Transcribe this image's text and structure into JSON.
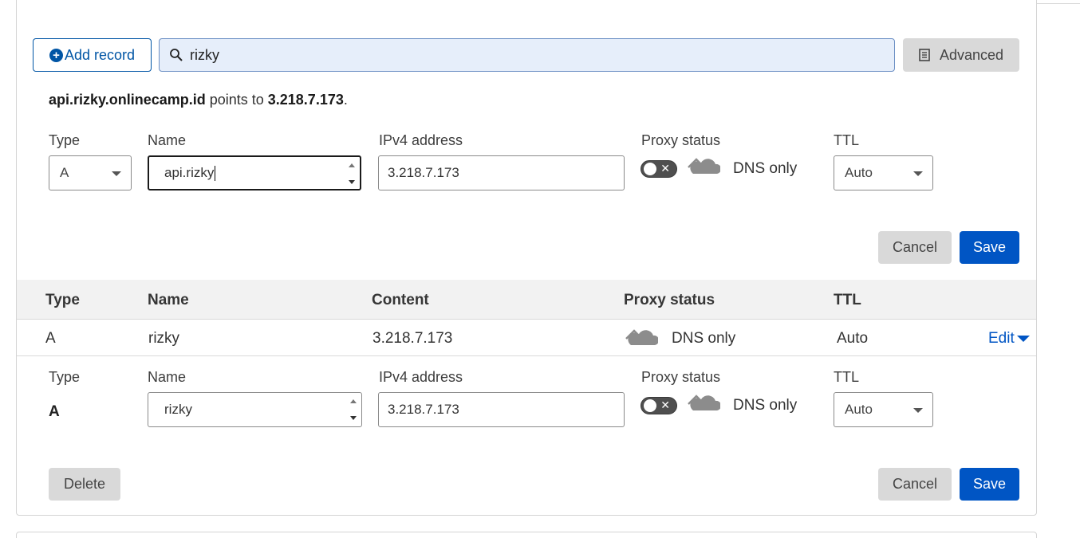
{
  "toolbar": {
    "add_record_label": "Add record",
    "search_value": "rizky",
    "advanced_label": "Advanced"
  },
  "preview": {
    "host": "api.rizky.onlinecamp.id",
    "middle": " points to ",
    "ip": "3.218.7.173",
    "end": "."
  },
  "new_record": {
    "type_label": "Type",
    "type_value": "A",
    "name_label": "Name",
    "name_value": "api.rizky",
    "ipv4_label": "IPv4 address",
    "ipv4_value": "3.218.7.173",
    "proxy_label": "Proxy status",
    "proxy_value": "DNS only",
    "ttl_label": "TTL",
    "ttl_value": "Auto",
    "cancel_label": "Cancel",
    "save_label": "Save"
  },
  "table": {
    "headers": [
      "Type",
      "Name",
      "Content",
      "Proxy status",
      "TTL"
    ],
    "rows": [
      {
        "type": "A",
        "name": "rizky",
        "content": "3.218.7.173",
        "proxy": "DNS only",
        "ttl": "Auto",
        "edit": "Edit"
      }
    ]
  },
  "edit_record": {
    "type_label": "Type",
    "type_value": "A",
    "name_label": "Name",
    "name_value": "rizky",
    "ipv4_label": "IPv4 address",
    "ipv4_value": "3.218.7.173",
    "proxy_label": "Proxy status",
    "proxy_value": "DNS only",
    "ttl_label": "TTL",
    "ttl_value": "Auto",
    "delete_label": "Delete",
    "cancel_label": "Cancel",
    "save_label": "Save"
  },
  "icons": {
    "add": "plus-circle-icon",
    "search": "search-icon",
    "advanced": "document-icon",
    "proxy": "dns-only-cloud-icon",
    "dropdown": "caret-down-icon"
  },
  "colors": {
    "accent": "#0055c4",
    "search_bg": "#e6eefa",
    "toggle_off": "#4f4f4f",
    "cloud": "#8c8c8c"
  }
}
